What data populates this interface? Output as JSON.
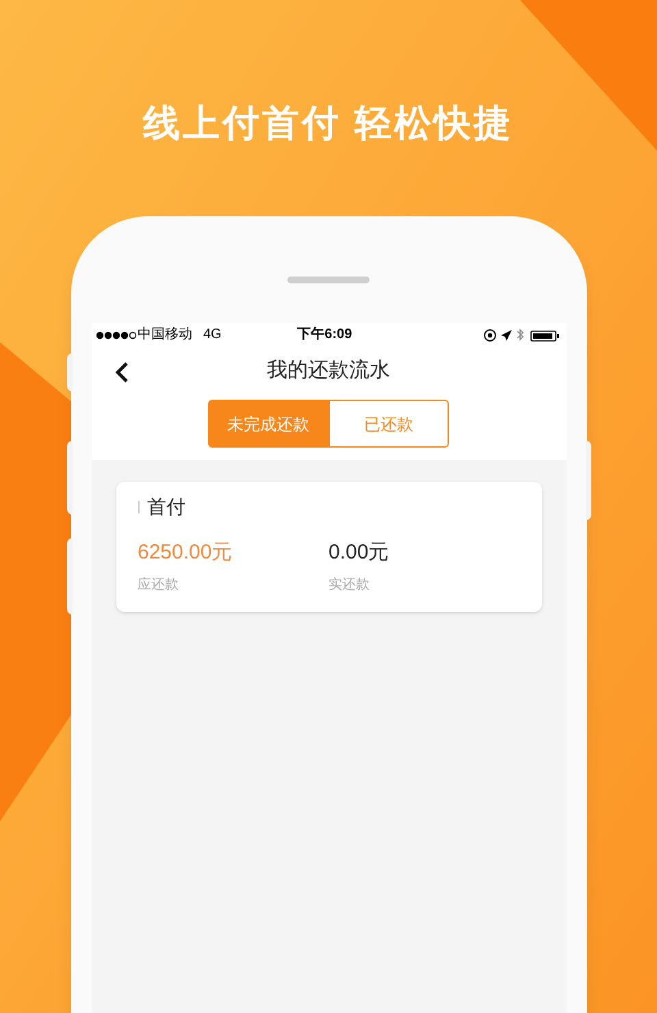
{
  "headline": "线上付首付 轻松快捷",
  "status_bar": {
    "carrier": "中国移动",
    "network": "4G",
    "time": "下午6:09"
  },
  "nav": {
    "title": "我的还款流水"
  },
  "tabs": [
    {
      "label": "未完成还款",
      "selected": true
    },
    {
      "label": "已还款",
      "selected": false
    }
  ],
  "records": [
    {
      "title": "首付",
      "amounts": [
        {
          "value": "6250.00元",
          "label": "应还款",
          "kind": "due"
        },
        {
          "value": "0.00元",
          "label": "实还款",
          "kind": "paid"
        }
      ]
    }
  ]
}
